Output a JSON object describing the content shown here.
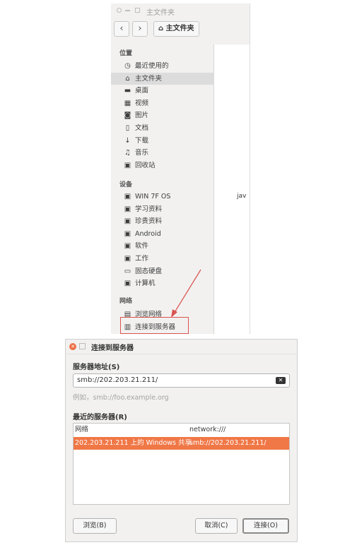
{
  "file_manager": {
    "window_title": "主文件夹",
    "breadcrumb": "主文件夹",
    "sections": {
      "places": "位置",
      "devices": "设备",
      "network": "网络"
    },
    "places": [
      {
        "icon": "clock-icon",
        "label": "最近使用的"
      },
      {
        "icon": "home-icon",
        "label": "主文件夹"
      },
      {
        "icon": "folder-icon",
        "label": "桌面"
      },
      {
        "icon": "video-icon",
        "label": "视频"
      },
      {
        "icon": "camera-icon",
        "label": "图片"
      },
      {
        "icon": "document-icon",
        "label": "文档"
      },
      {
        "icon": "download-icon",
        "label": "下载"
      },
      {
        "icon": "music-icon",
        "label": "音乐"
      },
      {
        "icon": "trash-icon",
        "label": "回收站"
      }
    ],
    "devices": [
      {
        "icon": "drive-icon",
        "label": "WIN 7F OS"
      },
      {
        "icon": "drive-icon",
        "label": "学习资料"
      },
      {
        "icon": "drive-icon",
        "label": "珍贵资料"
      },
      {
        "icon": "drive-icon",
        "label": "Android"
      },
      {
        "icon": "drive-icon",
        "label": "软件"
      },
      {
        "icon": "drive-icon",
        "label": "工作"
      },
      {
        "icon": "disk-icon",
        "label": "固态硬盘"
      },
      {
        "icon": "drive-icon",
        "label": "计算机"
      }
    ],
    "network_items": [
      {
        "icon": "network-icon",
        "label": "浏览网络"
      },
      {
        "icon": "server-icon",
        "label": "连接到服务器"
      }
    ],
    "content_partial_label": "jav"
  },
  "dialog": {
    "title": "连接到服务器",
    "address_label": "服务器地址(S)",
    "address_value": "smb://202.203.21.211/",
    "example_hint": "例如，smb://foo.example.org",
    "recent_label": "最近的服务器(R)",
    "recent": [
      {
        "name": "网络",
        "uri": "network:///"
      },
      {
        "name": "202.203.21.211 上的 Windows 共享",
        "uri": "smb://202.203.21.211/"
      }
    ],
    "browse_button": "浏览(B)",
    "cancel_button": "取消(C)",
    "connect_button": "连接(O)"
  },
  "colors": {
    "selection": "#f07746",
    "close_button": "#ec7047",
    "annotation_red": "#d9534f"
  }
}
